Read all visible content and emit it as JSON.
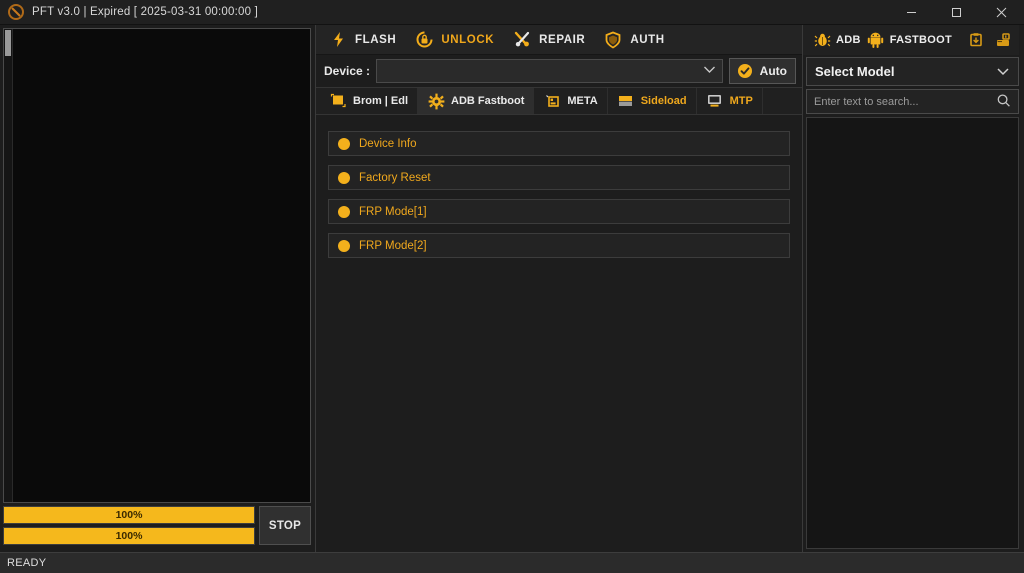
{
  "window": {
    "title": "PFT v3.0  | Expired [ 2025-03-31 00:00:00 ]",
    "app_icon": "crescent-logo-icon",
    "controls": {
      "minimize": "minimize-icon",
      "maximize": "maximize-icon",
      "close": "close-icon"
    }
  },
  "colors": {
    "accent_amber": "#f0a81d",
    "accent_amber_bright": "#f5b81c",
    "panel_bg": "#1d1d1d",
    "titlebar_bg": "#202020",
    "log_bg": "#0a0a0a",
    "statusbar_bg": "#2b2b2b",
    "text_light": "#e9e9e9"
  },
  "left_panel": {
    "log_text": "",
    "scrollbar": "vertical-scrollbar",
    "progress": [
      {
        "label": "100%",
        "value": 100
      },
      {
        "label": "100%",
        "value": 100
      }
    ],
    "stop_label": "STOP"
  },
  "center_panel": {
    "main_tabs": [
      {
        "label": "FLASH",
        "icon": "lightning-bolt-icon",
        "style": "light"
      },
      {
        "label": "UNLOCK",
        "icon": "padlock-rotate-icon",
        "style": "amber"
      },
      {
        "label": "REPAIR",
        "icon": "wrench-screwdriver-icon",
        "style": "light"
      },
      {
        "label": "AUTH",
        "icon": "shield-icon",
        "style": "light"
      }
    ],
    "device": {
      "label": "Device :",
      "value": "",
      "placeholder": "",
      "caret_icon": "chevron-down-icon",
      "auto_label": "Auto",
      "auto_icon": "check-circle-icon"
    },
    "sub_tabs": [
      {
        "label": "Brom | Edl",
        "icon": "chip-window-icon",
        "style": "light",
        "selected": false
      },
      {
        "label": "ADB Fastboot",
        "icon": "gear-icon",
        "style": "light",
        "selected": true
      },
      {
        "label": "META",
        "icon": "terminal-icon",
        "style": "light",
        "selected": false
      },
      {
        "label": "Sideload",
        "icon": "sdcard-icon",
        "style": "amber",
        "selected": false
      },
      {
        "label": "MTP",
        "icon": "monitor-icon",
        "style": "amber",
        "selected": false
      }
    ],
    "actions": [
      {
        "label": "Device Info",
        "bullet": "dot-icon"
      },
      {
        "label": "Factory Reset",
        "bullet": "dot-icon"
      },
      {
        "label": "FRP Mode[1]",
        "bullet": "dot-icon"
      },
      {
        "label": "FRP Mode[2]",
        "bullet": "dot-icon"
      }
    ]
  },
  "right_panel": {
    "toolbar": [
      {
        "label": "ADB",
        "icon": "bug-icon"
      },
      {
        "label": "FASTBOOT",
        "icon": "android-robot-icon"
      }
    ],
    "toolbar_icons": [
      {
        "icon": "save-box-icon"
      },
      {
        "icon": "export-box-icon"
      }
    ],
    "model_select": {
      "value": "Select Model",
      "caret_icon": "chevron-down-icon"
    },
    "model_search": {
      "value": "",
      "placeholder": "Enter text to search...",
      "icon": "search-icon"
    },
    "model_list_items": []
  },
  "statusbar": {
    "text": "READY"
  }
}
